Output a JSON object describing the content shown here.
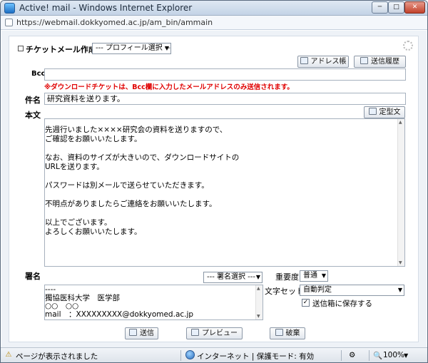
{
  "window": {
    "title": "Active! mail - Windows Internet Explorer",
    "url": "https://webmail.dokkyomed.ac.jp/am_bin/ammain",
    "min_glyph": "─",
    "max_glyph": "□",
    "close_glyph": "✕"
  },
  "compose": {
    "title": "チケットメール作成",
    "profile_select": "--- プロフィール選択 ---",
    "address_book_button": "アドレス帳",
    "sent_history_button": "送信履歴",
    "bcc_label": "Bcc",
    "bcc_value": "",
    "bcc_warning": "※ダウンロードチケットは、Bcc欄に入力したメールアドレスのみ送信されます。",
    "subject_label": "件名",
    "subject_value": "研究資料を送ります。",
    "body_label": "本文",
    "template_button": "定型文",
    "body_text": "先週行いました××××研究会の資料を送りますので、\nご確認をお願いいたします。\n\nなお、資料のサイズが大きいので、ダウンロードサイトの\nURLを送ります。\n\nパスワードは別メールで送らせていただきます。\n\n不明点がありましたらご連絡をお願いいたします。\n\n以上でございます。\nよろしくお願いいたします。",
    "signature_label": "署名",
    "signature_select": "--- 署名選択 ---",
    "signature_text": "----\n獨協医科大学　医学部\n○○　○○\nmail　：XXXXXXXXX@dokkyomed.ac.jp",
    "priority_label": "重要度",
    "priority_value": "普通",
    "charset_label": "文字セット",
    "charset_value": "自動判定",
    "save_sent_label": "送信箱に保存する",
    "save_sent_checked": "✓",
    "send_button": "送信",
    "preview_button": "プレビュー",
    "discard_button": "破棄"
  },
  "statusbar": {
    "page_status": "ページが表示されました",
    "zone": "インターネット | 保護モード: 有効",
    "zoom": "100%",
    "zoom_arrow": "▼"
  }
}
